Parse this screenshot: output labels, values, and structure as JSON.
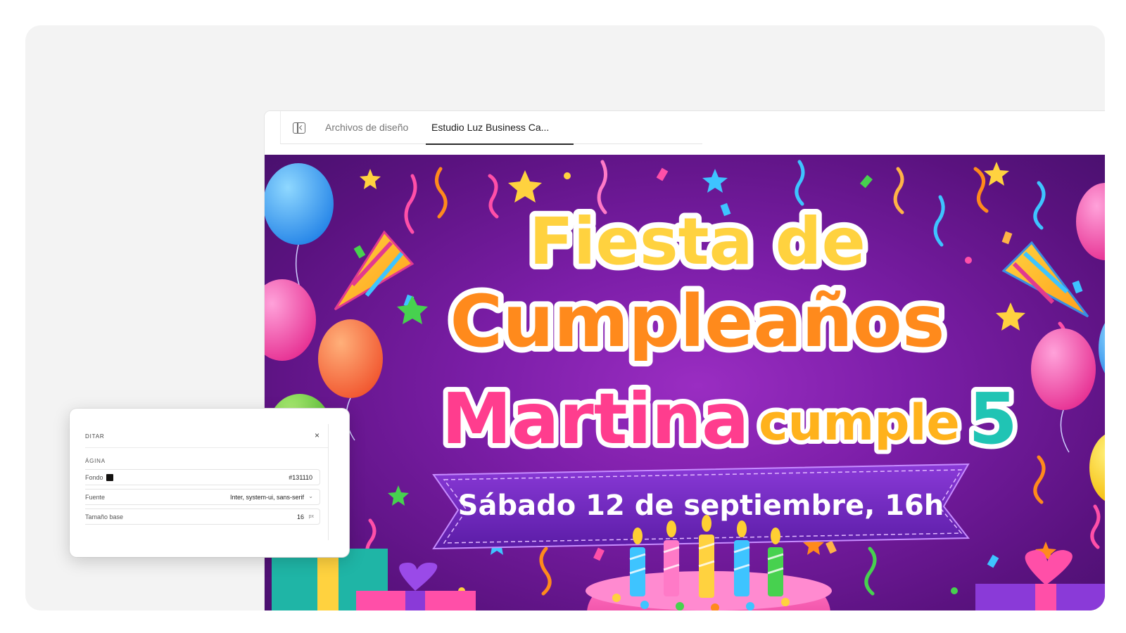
{
  "tabs": {
    "files_label": "Archivos de diseño",
    "active_label": "Estudio Luz Business Ca..."
  },
  "design": {
    "line1": "Fiesta de",
    "line2": "Cumpleaños",
    "name": "Martina",
    "cumple": "cumple",
    "age": "5",
    "date": "Sábado 12 de septiembre, 16h"
  },
  "panel": {
    "title": "DITAR",
    "close": "×",
    "section": "ÁGINA",
    "fondo_label": "Fondo",
    "fondo_value": "#131110",
    "fuente_label": "Fuente",
    "fuente_value": "Inter, system-ui, sans-serif",
    "tamano_label": "Tamaño base",
    "tamano_value": "16",
    "tamano_unit": "px"
  },
  "icons": [
    "sidebar-toggle-icon",
    "close-icon",
    "chevron-down-icon",
    "balloon-icon",
    "party-horn-icon",
    "gift-icon",
    "cake-icon",
    "star-icon"
  ],
  "colors": {
    "canvas_bg": "#7c1ea8",
    "fondo_swatch": "#131110"
  }
}
